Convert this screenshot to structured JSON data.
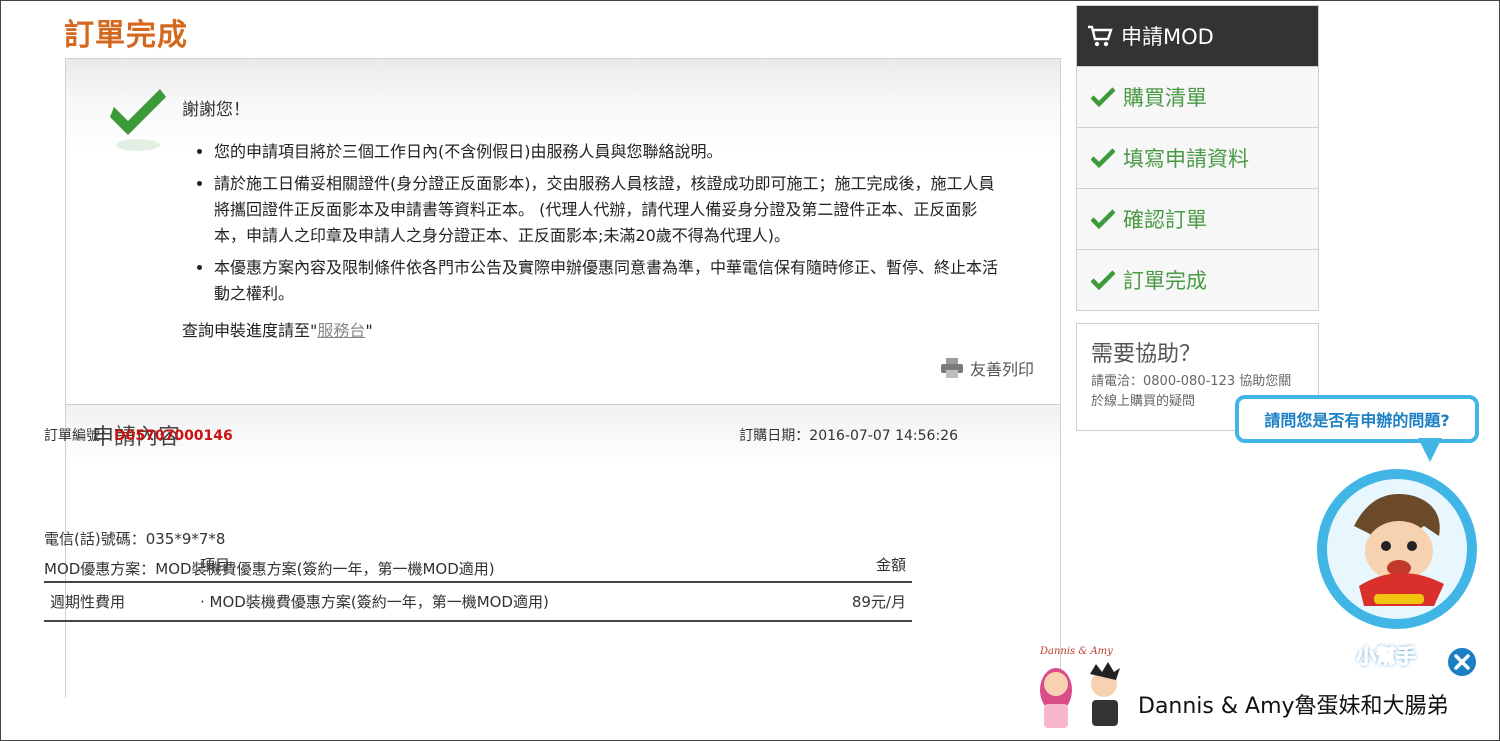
{
  "page_title": "訂單完成",
  "thanks": {
    "title": "謝謝您！",
    "bullets": [
      "您的申請項目將於三個工作日內(不含例假日)由服務人員與您聯絡說明。",
      "請於施工日備妥相關證件(身分證正反面影本)，交由服務人員核證，核證成功即可施工；施工完成後，施工人員將攜回證件正反面影本及申請書等資料正本。 (代理人代辦，請代理人備妥身分證及第二證件正本、正反面影本，申請人之印章及申請人之身分證正本、正反面影本;未滿20歲不得為代理人)。",
      "本優惠方案內容及限制條件依各門市公告及實際申辦優惠同意書為準，中華電信保有隨時修正、暫停、終止本活動之權利。"
    ],
    "progress_prefix": "查詢申裝進度請至\"",
    "progress_link": "服務台",
    "progress_suffix": "\"",
    "print_label": "友善列印"
  },
  "content": {
    "heading": "申請內容",
    "order_no_label": "訂單編號：",
    "order_no": "D05707000146",
    "order_date": "訂購日期：2016-07-07 14:56:26",
    "phone": "電信(話)號碼：035*9*7*8",
    "plan": "MOD優惠方案：MOD裝機費優惠方案(簽約一年，第一機MOD適用)",
    "table": {
      "headers": [
        "",
        "項目",
        "金額"
      ],
      "rows": [
        [
          "週期性費用",
          "· MOD裝機費優惠方案(簽約一年，第一機MOD適用)",
          "89元/月"
        ]
      ]
    }
  },
  "sidebar": {
    "header": "申請MOD",
    "steps": [
      "購買清單",
      "填寫申請資料",
      "確認訂單",
      "訂單完成"
    ]
  },
  "help": {
    "title": "需要協助？",
    "text": "請電洽：0800-080-123 協助您關於線上購買的疑問"
  },
  "helper": {
    "bubble": "請問您是否有申辦的問題?",
    "label": "小幫手"
  },
  "watermark": {
    "signature": "Dannis & Amy",
    "text": "Dannis & Amy魯蛋妹和大腸弟"
  },
  "colors": {
    "title_orange": "#d4681f",
    "check_green": "#4a9a46",
    "order_red": "#cc1111",
    "sidebar_dark": "#333333",
    "helper_blue": "#41b6e6"
  }
}
